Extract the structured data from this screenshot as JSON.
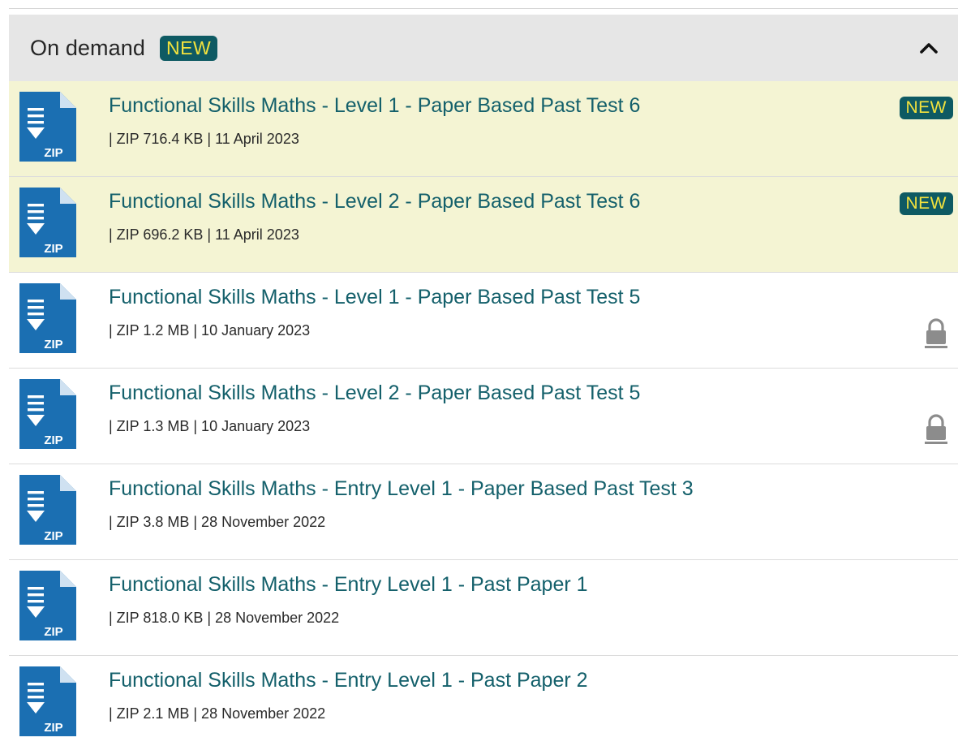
{
  "section": {
    "title": "On demand",
    "badge": "NEW",
    "expanded": true
  },
  "colors": {
    "link": "#14606b",
    "badge_bg": "#0e5a63",
    "badge_text": "#f3e23d",
    "highlight_row": "#f4f4d3",
    "header_bg": "#e6e6e6",
    "file_icon": "#1b6fb2"
  },
  "items": [
    {
      "title": "Functional Skills Maths - Level 1 - Paper Based Past Test 6",
      "meta": "| ZIP 716.4 KB | 11 April 2023",
      "icon_label": "ZIP",
      "badge": "NEW",
      "highlight": true,
      "locked": false
    },
    {
      "title": "Functional Skills Maths - Level 2 - Paper Based Past Test 6",
      "meta": "| ZIP 696.2 KB | 11 April 2023",
      "icon_label": "ZIP",
      "badge": "NEW",
      "highlight": true,
      "locked": false
    },
    {
      "title": "Functional Skills Maths - Level 1 - Paper Based Past Test 5",
      "meta": "| ZIP 1.2 MB | 10 January 2023",
      "icon_label": "ZIP",
      "badge": "",
      "highlight": false,
      "locked": true
    },
    {
      "title": "Functional Skills Maths - Level 2 - Paper Based Past Test 5",
      "meta": "| ZIP 1.3 MB | 10 January 2023",
      "icon_label": "ZIP",
      "badge": "",
      "highlight": false,
      "locked": true
    },
    {
      "title": "Functional Skills Maths - Entry Level 1 - Paper Based Past Test 3",
      "meta": "| ZIP 3.8 MB | 28 November 2022",
      "icon_label": "ZIP",
      "badge": "",
      "highlight": false,
      "locked": false
    },
    {
      "title": "Functional Skills Maths - Entry Level 1 - Past Paper 1",
      "meta": "| ZIP 818.0 KB | 28 November 2022",
      "icon_label": "ZIP",
      "badge": "",
      "highlight": false,
      "locked": false
    },
    {
      "title": "Functional Skills Maths - Entry Level 1 - Past Paper 2",
      "meta": "| ZIP 2.1 MB | 28 November 2022",
      "icon_label": "ZIP",
      "badge": "",
      "highlight": false,
      "locked": false
    }
  ]
}
